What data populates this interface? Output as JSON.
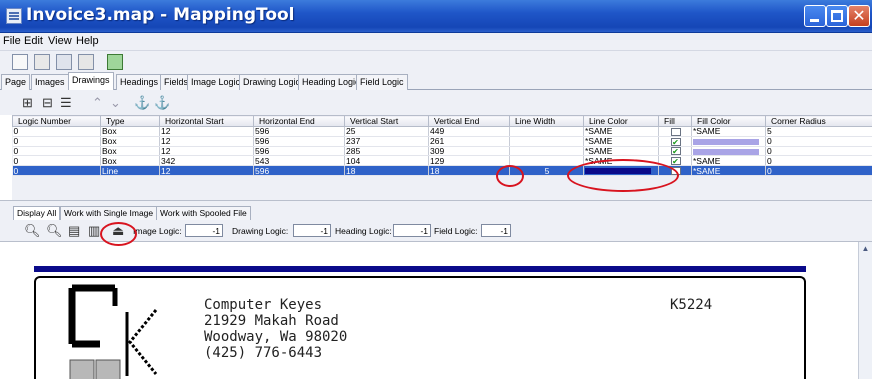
{
  "window": {
    "title": "Invoice3.map - MappingTool"
  },
  "menu": [
    "File",
    "Edit",
    "View",
    "Help"
  ],
  "toolbar_icons": [
    "new-file-icon",
    "open-folder-icon",
    "save-icon",
    "print-icon",
    "help-icon"
  ],
  "main_tabs": [
    "Page",
    "Images",
    "Drawings",
    "Headings",
    "Fields",
    "Image Logic",
    "Drawing Logic",
    "Heading Logic",
    "Field Logic"
  ],
  "main_tabs_active": "Drawings",
  "grid": {
    "columns": [
      "Logic Number",
      "Type",
      "Horizontal Start",
      "Horizontal End",
      "Vertical Start",
      "Vertical End",
      "Line Width",
      "Line Color",
      "Fill",
      "Fill Color",
      "Corner Radius"
    ],
    "rows": [
      {
        "logic": "0",
        "type": "Box",
        "hstart": "12",
        "hend": "596",
        "vstart": "25",
        "vend": "449",
        "width": "",
        "lcolor": "*SAME",
        "fill": false,
        "fcolor": "*SAME",
        "radius": "5"
      },
      {
        "logic": "0",
        "type": "Box",
        "hstart": "12",
        "hend": "596",
        "vstart": "237",
        "vend": "261",
        "width": "",
        "lcolor": "*SAME",
        "fill": true,
        "fcolor": "",
        "radius": "0"
      },
      {
        "logic": "0",
        "type": "Box",
        "hstart": "12",
        "hend": "596",
        "vstart": "285",
        "vend": "309",
        "width": "",
        "lcolor": "*SAME",
        "fill": true,
        "fcolor": "",
        "radius": "0"
      },
      {
        "logic": "0",
        "type": "Box",
        "hstart": "342",
        "hend": "543",
        "vstart": "104",
        "vend": "129",
        "width": "",
        "lcolor": "*SAME",
        "fill": true,
        "fcolor": "*SAME",
        "radius": "0"
      },
      {
        "logic": "0",
        "type": "Line",
        "hstart": "12",
        "hend": "596",
        "vstart": "18",
        "vend": "18",
        "width": "5",
        "lcolor": "",
        "fill": false,
        "fcolor": "*SAME",
        "radius": "0"
      }
    ],
    "swatch_colors": {
      "lavender": "#a9a4e6",
      "navy": "#0a0a8a"
    },
    "selected_row": 4
  },
  "view_tabs": [
    "Display All",
    "Work with Single Image",
    "Work with Spooled File"
  ],
  "view_tabs_active": "Display All",
  "logic_controls": {
    "image_logic_label": "Image Logic:",
    "image_logic_value": "-1",
    "drawing_logic_label": "Drawing Logic:",
    "drawing_logic_value": "-1",
    "heading_logic_label": "Heading Logic:",
    "heading_logic_value": "-1",
    "field_logic_label": "Field Logic:",
    "field_logic_value": "-1"
  },
  "document": {
    "address": [
      "Computer Keyes",
      "21929 Makah Road",
      "Woodway, Wa  98020",
      "(425) 776-6443"
    ],
    "invoice_number": "K5224"
  },
  "accent_colors": {
    "titlebar": "#1f56c8",
    "selection": "#2f62c8",
    "highlight_ring": "#d8141f"
  }
}
